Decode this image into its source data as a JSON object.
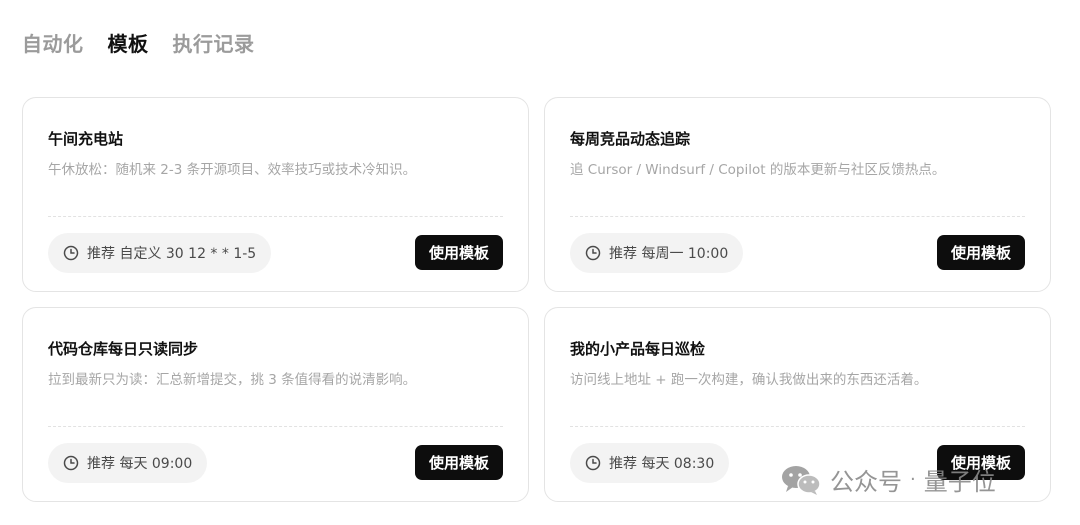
{
  "tabs": [
    {
      "label": "自动化"
    },
    {
      "label": "模板"
    },
    {
      "label": "执行记录"
    }
  ],
  "cards": [
    {
      "title": "午间充电站",
      "description": "午休放松：随机来 2-3 条开源项目、效率技巧或技术冷知识。",
      "schedule": "推荐 自定义 30 12 * * 1-5",
      "button": "使用模板"
    },
    {
      "title": "每周竞品动态追踪",
      "description": "追 Cursor / Windsurf / Copilot 的版本更新与社区反馈热点。",
      "schedule": "推荐 每周一 10:00",
      "button": "使用模板"
    },
    {
      "title": "代码仓库每日只读同步",
      "description": "拉到最新只为读：汇总新增提交，挑 3 条值得看的说清影响。",
      "schedule": "推荐 每天 09:00",
      "button": "使用模板"
    },
    {
      "title": "我的小产品每日巡检",
      "description": "访问线上地址 + 跑一次构建，确认我做出来的东西还活着。",
      "schedule": "推荐 每天 08:30",
      "button": "使用模板"
    }
  ],
  "watermark": {
    "prefix": "公众号",
    "separator": "·",
    "name": "量子位"
  }
}
